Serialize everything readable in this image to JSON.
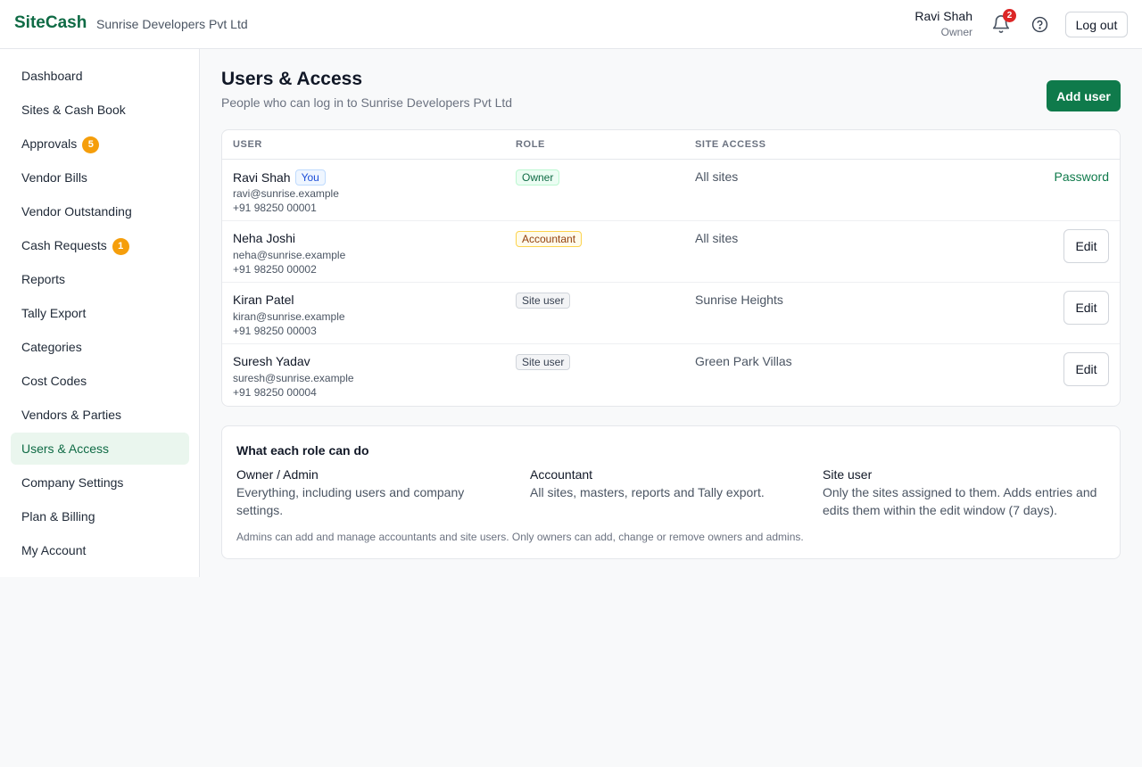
{
  "header": {
    "brand": "SiteCash",
    "company": "Sunrise Developers Pvt Ltd",
    "user_name": "Ravi Shah",
    "user_role": "Owner",
    "notification_count": "2",
    "logout_label": "Log out"
  },
  "sidebar": {
    "items": [
      {
        "label": "Dashboard"
      },
      {
        "label": "Sites & Cash Book"
      },
      {
        "label": "Approvals",
        "badge": "5"
      },
      {
        "label": "Vendor Bills"
      },
      {
        "label": "Vendor Outstanding"
      },
      {
        "label": "Cash Requests",
        "badge": "1"
      },
      {
        "label": "Reports"
      },
      {
        "label": "Tally Export"
      },
      {
        "label": "Categories"
      },
      {
        "label": "Cost Codes"
      },
      {
        "label": "Vendors & Parties"
      },
      {
        "label": "Users & Access",
        "active": true
      },
      {
        "label": "Company Settings"
      },
      {
        "label": "Plan & Billing"
      },
      {
        "label": "My Account"
      }
    ]
  },
  "main": {
    "title": "Users & Access",
    "subtitle": "People who can log in to Sunrise Developers Pvt Ltd",
    "add_user_label": "Add user",
    "table": {
      "headers": {
        "user": "USER",
        "role": "ROLE",
        "site_access": "SITE ACCESS"
      },
      "rows": [
        {
          "name": "Ravi Shah",
          "you_badge": "You",
          "email": "ravi@sunrise.example",
          "phone": "+91 98250 00001",
          "role": "Owner",
          "site_access": "All sites",
          "action": "Password"
        },
        {
          "name": "Neha Joshi",
          "email": "neha@sunrise.example",
          "phone": "+91 98250 00002",
          "role": "Accountant",
          "site_access": "All sites",
          "action": "Edit"
        },
        {
          "name": "Kiran Patel",
          "email": "kiran@sunrise.example",
          "phone": "+91 98250 00003",
          "role": "Site user",
          "site_access": "Sunrise Heights",
          "action": "Edit"
        },
        {
          "name": "Suresh Yadav",
          "email": "suresh@sunrise.example",
          "phone": "+91 98250 00004",
          "role": "Site user",
          "site_access": "Green Park Villas",
          "action": "Edit"
        }
      ]
    },
    "roles": {
      "title": "What each role can do",
      "items": [
        {
          "title": "Owner / Admin",
          "desc": "Everything, including users and company settings."
        },
        {
          "title": "Accountant",
          "desc": "All sites, masters, reports and Tally export."
        },
        {
          "title": "Site user",
          "desc": "Only the sites assigned to them. Adds entries and edits them within the edit window (7 days)."
        }
      ],
      "note": "Admins can add and manage accountants and site users. Only owners can add, change or remove owners and admins."
    }
  },
  "colors": {
    "brand": "#0f6b45",
    "primary_button": "#0f7a4b",
    "active_nav_bg": "#eaf6ee",
    "badge_orange": "#f59e0b",
    "notification_red": "#dc2626"
  },
  "icons": {
    "notifications": "bell-icon",
    "help": "help-circle-icon"
  }
}
